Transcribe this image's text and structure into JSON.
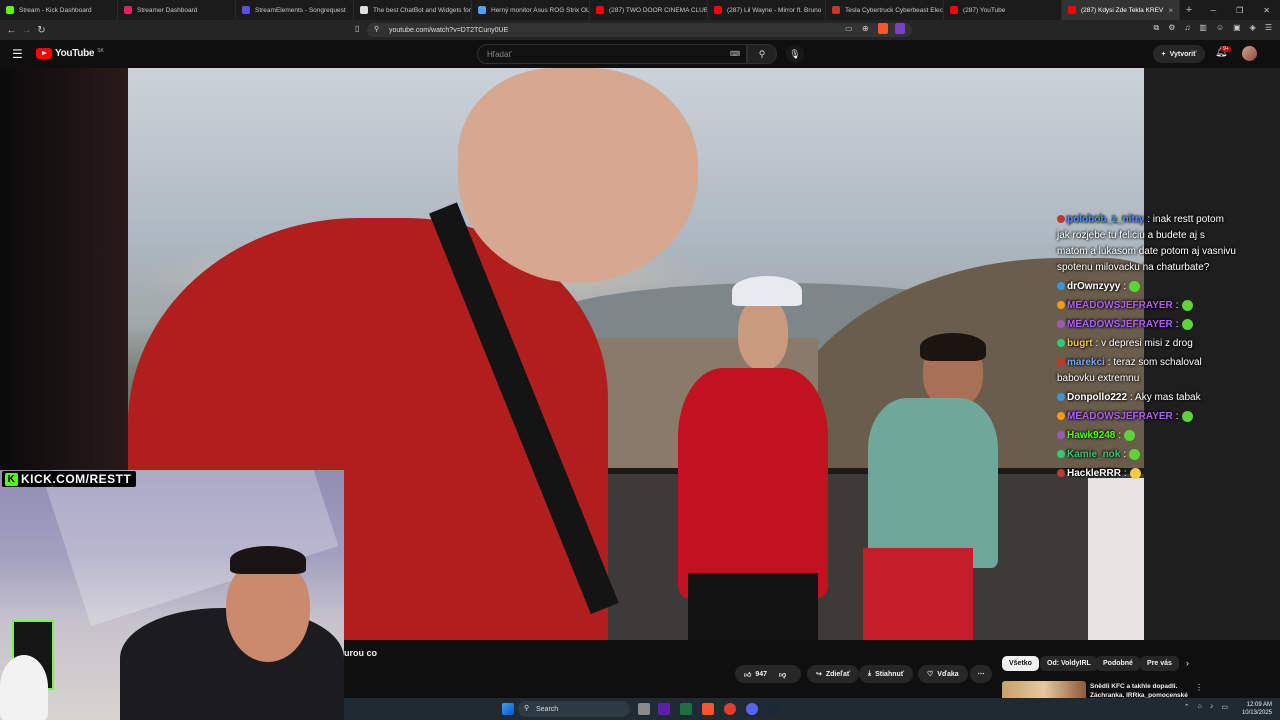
{
  "browser": {
    "tabs": [
      {
        "label": "Stream - Kick Dashboard",
        "color": "#53fc18"
      },
      {
        "label": "Streamer Dashboard",
        "color": "#e91e63"
      },
      {
        "label": "StreamElements - Songrequest",
        "color": "#5c4ee5"
      },
      {
        "label": "The best ChatBot and Widgets for",
        "color": "#dddddd"
      },
      {
        "label": "Herný monitor Asus ROG Strix OL",
        "color": "#4aa3ff"
      },
      {
        "label": "(287) TWO DOOR CINEMA CLUB |",
        "color": "#ff0000"
      },
      {
        "label": "(287) Lil Wayne - Mirror ft. Bruno",
        "color": "#ff0000"
      },
      {
        "label": "Tesla Cybertruck Cyberbeast Electr",
        "color": "#c0392b"
      },
      {
        "label": "(287) YouTube",
        "color": "#ff0000"
      },
      {
        "label": "(287) Kdysi Zde Tekla KREV",
        "color": "#ff0000",
        "active": true
      }
    ],
    "url": "youtube.com/watch?v=DT2TCuny0UE",
    "new_tab": "+"
  },
  "youtube": {
    "logo_text": "YouTube",
    "region": "SK",
    "search_placeholder": "Hľadať",
    "create_label": "Vytvoriť",
    "notif_count": "9+"
  },
  "chat": [
    {
      "user": "polobob_z_nitry",
      "color": "#4a8cff",
      "text": ": inak restt potom jak rozjebe tu feliciu a budete aj s matom a lukasom date potom aj vasnivu spotenu milovacku na chaturbate?"
    },
    {
      "user": "drOwnzyyy",
      "color": "#ffffff",
      "text": ":"
    },
    {
      "user": "MEADOWSJEFRAYER",
      "color": "#b05cff",
      "text": ":"
    },
    {
      "user": "MEADOWSJEFRAYER",
      "color": "#b05cff",
      "text": ":"
    },
    {
      "user": "bugrt",
      "color": "#f5c542",
      "text": ": v depresi misi z drog"
    },
    {
      "user": "marekci",
      "color": "#6fa8ff",
      "text": ": teraz som schaloval babovku extremnu"
    },
    {
      "user": "Donpollo222",
      "color": "#ffffff",
      "text": ": Aky mas tabak"
    },
    {
      "user": "MEADOWSJEFRAYER",
      "color": "#b05cff",
      "text": ":"
    },
    {
      "user": "Hawk9248",
      "color": "#53fc18",
      "text": ":"
    },
    {
      "user": "Kamie_nok",
      "color": "#2ecc71",
      "text": ":"
    },
    {
      "user": "HackleRRR",
      "color": "#ffffff",
      "text": ":"
    }
  ],
  "overlay": {
    "kick_label": "KICK.COM/RESTT"
  },
  "video": {
    "title_fragment": "urou co"
  },
  "actions": {
    "likes": "947",
    "share": "Zdieľať",
    "download": "Stiahnuť",
    "thanks": "Vďaka",
    "more": "⋯"
  },
  "chips": [
    "Všetko",
    "Od: VoldyIRL",
    "Podobné",
    "Pre vás"
  ],
  "recommendation": {
    "title": "Snědli KFC a takhle dopadli. Záchranka. IRRka_pomocenské"
  },
  "taskbar": {
    "search": "Search",
    "time": "12:09 AM",
    "date": "10/13/2025"
  }
}
